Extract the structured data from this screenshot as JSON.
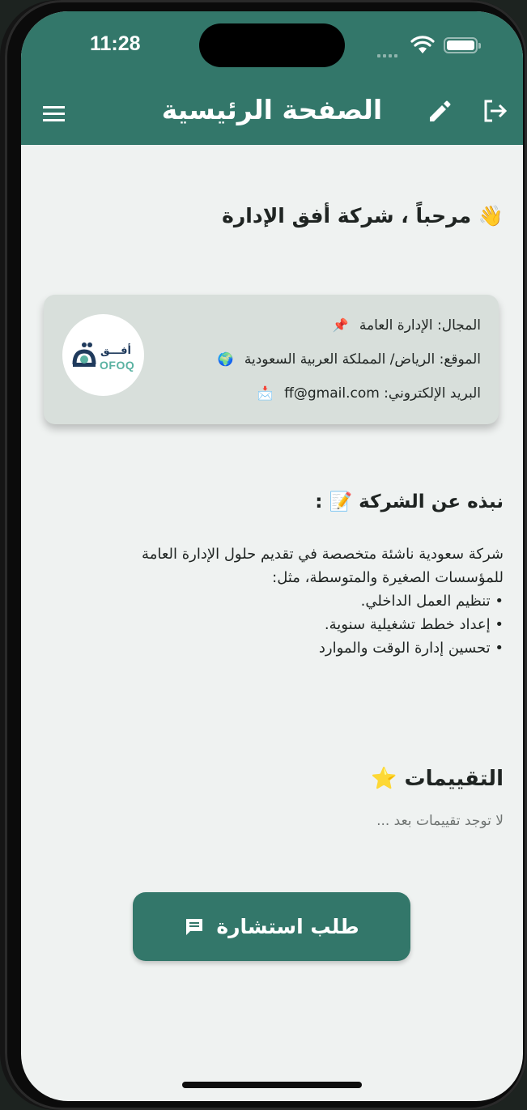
{
  "status_bar": {
    "time": "11:28"
  },
  "header": {
    "title": "الصفحة الرئيسية",
    "icons": {
      "menu": "menu-icon",
      "edit": "edit-pencil-icon",
      "logout": "logout-icon"
    }
  },
  "welcome": {
    "emoji": "👋",
    "text": "مرحباً ، شركة أفق الإدارة"
  },
  "company_card": {
    "logo": {
      "arabic": "أفـــق",
      "latin": "OFOQ"
    },
    "field": {
      "emoji": "📌",
      "text": "المجال: الإدارة العامة"
    },
    "location": {
      "emoji": "🌍",
      "text": "الموقع: الرياض/ المملكة العربية السعودية"
    },
    "email": {
      "emoji": "📩",
      "text": "البريد الإلكتروني: ff@gmail.com"
    }
  },
  "about": {
    "title": "نبذه عن الشركة",
    "emoji": "📝",
    "suffix": ":",
    "lines": [
      "شركة سعودية ناشئة متخصصة في تقديم حلول الإدارة العامة",
      "للمؤسسات الصغيرة والمتوسطة، مثل:",
      "• تنظيم العمل الداخلي.",
      "• إعداد خطط تشغيلية سنوية.",
      "• تحسين إدارة الوقت والموارد"
    ]
  },
  "reviews": {
    "title": "التقييمات",
    "emoji": "⭐",
    "empty_text": "لا توجد تقييمات بعد ..."
  },
  "consult_button": {
    "label": "طلب استشارة",
    "icon": "chat-message-icon"
  },
  "colors": {
    "primary": "#33776a",
    "background": "#eff2f1",
    "card": "#d8dfdb"
  }
}
